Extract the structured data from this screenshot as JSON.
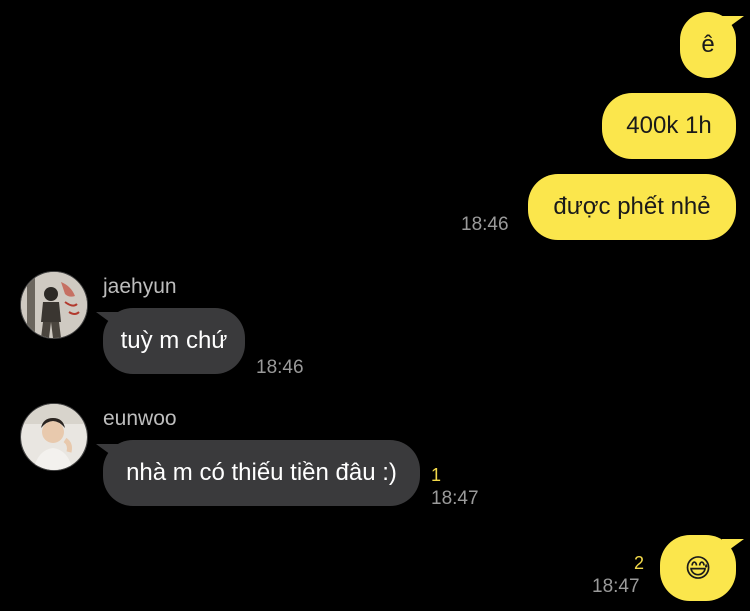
{
  "messages": {
    "m1": {
      "text": "ê"
    },
    "m2": {
      "text": "400k 1h"
    },
    "m3": {
      "text": "được phết nhẻ",
      "time": "18:46"
    },
    "m4": {
      "sender": "jaehyun",
      "text": "tuỳ m chứ",
      "time": "18:46"
    },
    "m5": {
      "sender": "eunwoo",
      "text": "nhà m có thiếu tiền đâu :)",
      "unread": "1",
      "time": "18:47"
    },
    "m6": {
      "text": "😅",
      "unread": "2",
      "time": "18:47"
    }
  },
  "colors": {
    "background": "#000000",
    "outgoing_bubble": "#fbe64c",
    "incoming_bubble": "#3a3a3c",
    "timestamp": "#9a9a9a",
    "unread_count": "#f2d94a"
  },
  "icons": {
    "avatar_jaehyun": "avatar-photo",
    "avatar_eunwoo": "avatar-photo",
    "emoji": "sweat-smile-emoji"
  }
}
